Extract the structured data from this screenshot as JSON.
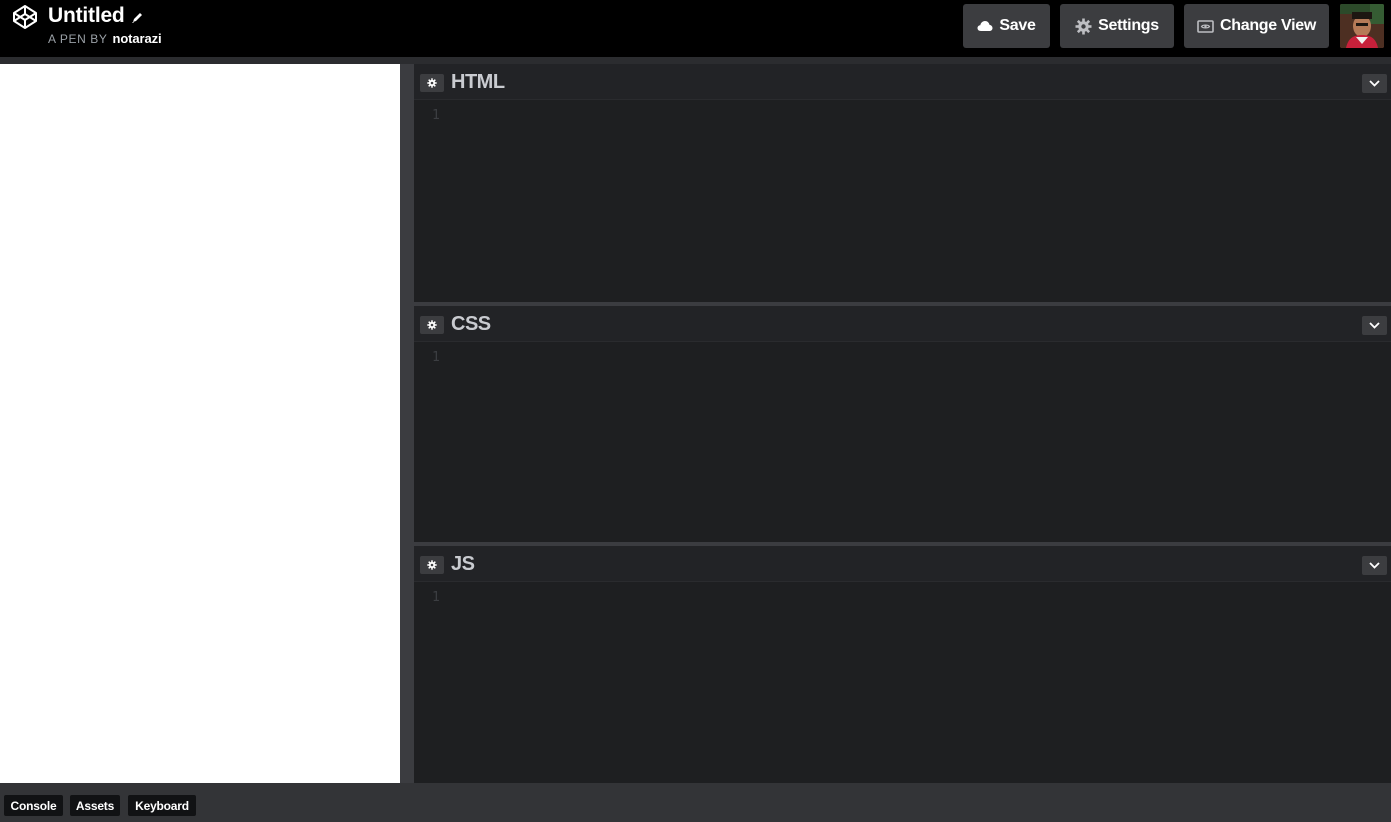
{
  "header": {
    "logo_icon": "codepen-logo-icon",
    "title": "Untitled",
    "edit_icon": "pencil-icon",
    "byline_prefix": "A PEN BY",
    "username": "notarazi",
    "buttons": {
      "save": {
        "label": "Save",
        "icon": "cloud-icon"
      },
      "settings": {
        "label": "Settings",
        "icon": "gear-icon"
      },
      "change_view": {
        "label": "Change View",
        "icon": "view-icon"
      }
    },
    "avatar_icon": "user-avatar"
  },
  "editors": [
    {
      "title": "HTML",
      "line_number": "1"
    },
    {
      "title": "CSS",
      "line_number": "1"
    },
    {
      "title": "JS",
      "line_number": "1"
    }
  ],
  "footer": {
    "console": "Console",
    "assets": "Assets",
    "keyboard": "Keyboard"
  },
  "colors": {
    "header_bg": "#000000",
    "editor_bg": "#1e1f21",
    "button_bg": "#3c3d40",
    "preview_bg": "#ffffff"
  }
}
